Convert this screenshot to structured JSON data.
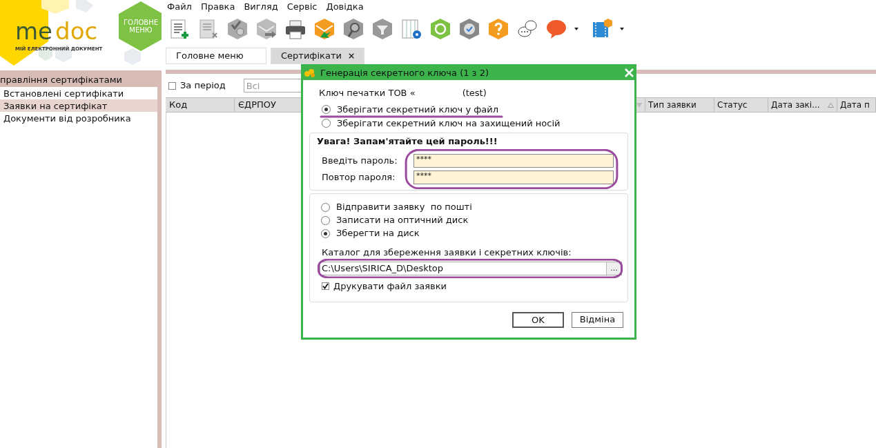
{
  "logo": {
    "brand_left": "me",
    "brand_right": "doc",
    "tagline": "МІЙ ЕЛЕКТРОННИЙ ДОКУМЕНТ",
    "main_menu_button": "ГОЛОВНЕ МЕНЮ"
  },
  "menu": [
    "Файл",
    "Правка",
    "Вигляд",
    "Сервіс",
    "Довідка"
  ],
  "tabs": [
    {
      "label": "Головне меню",
      "selected": false
    },
    {
      "label": "Сертифікати",
      "selected": true
    }
  ],
  "sidebar": {
    "title": "правління сертифікатами",
    "items": [
      {
        "label": "Встановлені сертифікати",
        "selected": false
      },
      {
        "label": "Заявки на сертифікат",
        "selected": true
      },
      {
        "label": "Документи від розробника",
        "selected": false
      }
    ]
  },
  "filter": {
    "period_label": "За період",
    "period_checked": false,
    "select_value": "Всі"
  },
  "table": {
    "left_columns": [
      {
        "label": "Код"
      },
      {
        "label": "ЄДРПОУ"
      }
    ],
    "right_columns": [
      {
        "label": "Тип заявки",
        "sorted": false
      },
      {
        "label": "Статус",
        "sorted": false
      },
      {
        "label": "Дата закі...",
        "sorted": true
      },
      {
        "label": "Дата п",
        "sorted": false
      }
    ]
  },
  "dialog": {
    "title": "Генерація секретного ключа (1 з 2)",
    "key_label": "Ключ печатки ТОВ «",
    "key_suffix": "(test)",
    "storage_options": [
      {
        "label": "Зберігати секретний ключ у файл",
        "selected": true
      },
      {
        "label": "Зберігати секретний ключ на захищений носій",
        "selected": false
      }
    ],
    "warning": "Увага! Запам'ятайте цей пароль!!!",
    "password_fields": [
      {
        "label": "Введіть пароль:",
        "value": "****"
      },
      {
        "label": "Повтор пароля:",
        "value": "****"
      }
    ],
    "send_options": [
      {
        "label": "Відправити заявку  по пошті",
        "selected": false
      },
      {
        "label": "Записати на оптичний диск",
        "selected": false
      },
      {
        "label": "Зберегти на диск",
        "selected": true
      }
    ],
    "folder_label": "Каталог для збереження заявки і секретних ключів:",
    "folder_value": "C:\\Users\\SIRICA_D\\Desktop",
    "browse_button": "...",
    "print_label": "Друкувати файл заявки",
    "print_checked": true,
    "buttons": [
      "OK",
      "Відміна"
    ]
  }
}
